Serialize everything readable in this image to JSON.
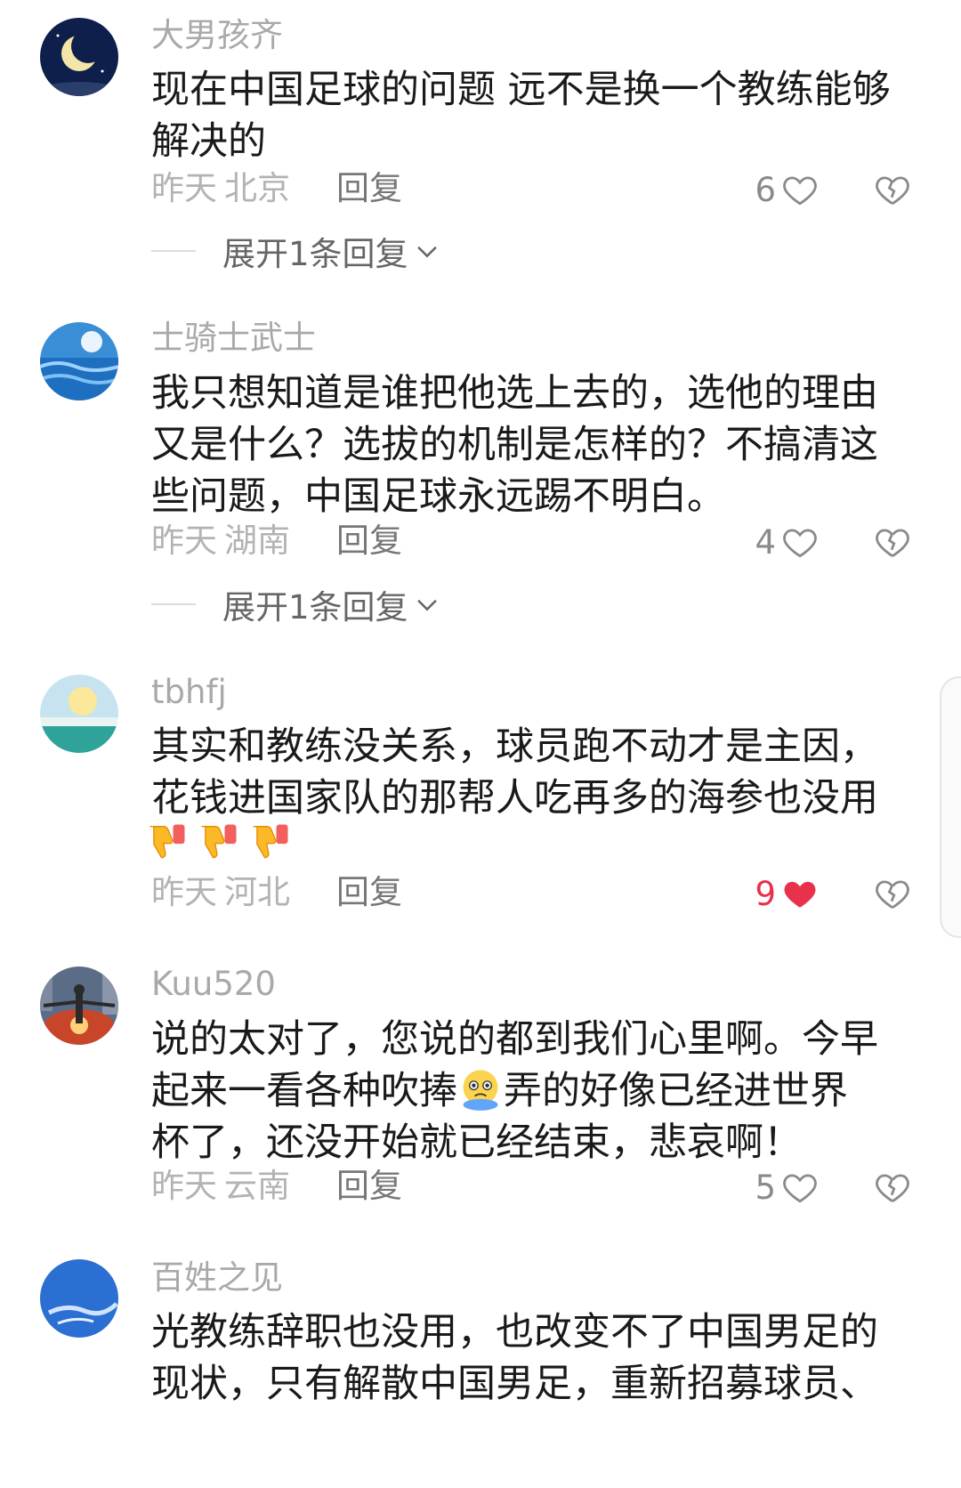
{
  "comments": [
    {
      "username": "大男孩齐",
      "text": "现在中国足球的问题 远不是换一个教练能够\n解决的",
      "time": "昨天",
      "location": "北京",
      "reply": "回复",
      "likes": "6",
      "liked": false,
      "expand": "展开1条回复"
    },
    {
      "username": "士骑士武士",
      "text": "我只想知道是谁把他选上去的，选他的理由\n又是什么？选拔的机制是怎样的？不搞清这\n些问题，中国足球永远踢不明白。",
      "time": "昨天",
      "location": "湖南",
      "reply": "回复",
      "likes": "4",
      "liked": false,
      "expand": "展开1条回复"
    },
    {
      "username": "tbhfj",
      "text": "其实和教练没关系，球员跑不动才是主因，\n花钱进国家队的那帮人吃再多的海参也没用",
      "emojis": [
        "thumbs-down-icon",
        "thumbs-down-icon",
        "thumbs-down-icon"
      ],
      "time": "昨天",
      "location": "河北",
      "reply": "回复",
      "likes": "9",
      "liked": true,
      "colors": {
        "liked": "#e8314b"
      }
    },
    {
      "username": "Kuu520",
      "text_part1": "说的太对了，您说的都到我们心里啊。今早\n起来一看各种吹捧",
      "text_part2": "弄的好像已经进世界\n杯了，还没开始就已经结束，悲哀啊！",
      "emoji": "crying-face-icon",
      "time": "昨天",
      "location": "云南",
      "reply": "回复",
      "likes": "5",
      "liked": false
    },
    {
      "username": "百姓之见",
      "text": "光教练辞职也没用，也改变不了中国男足的\n现状，只有解散中国男足，重新招募球员、"
    }
  ]
}
